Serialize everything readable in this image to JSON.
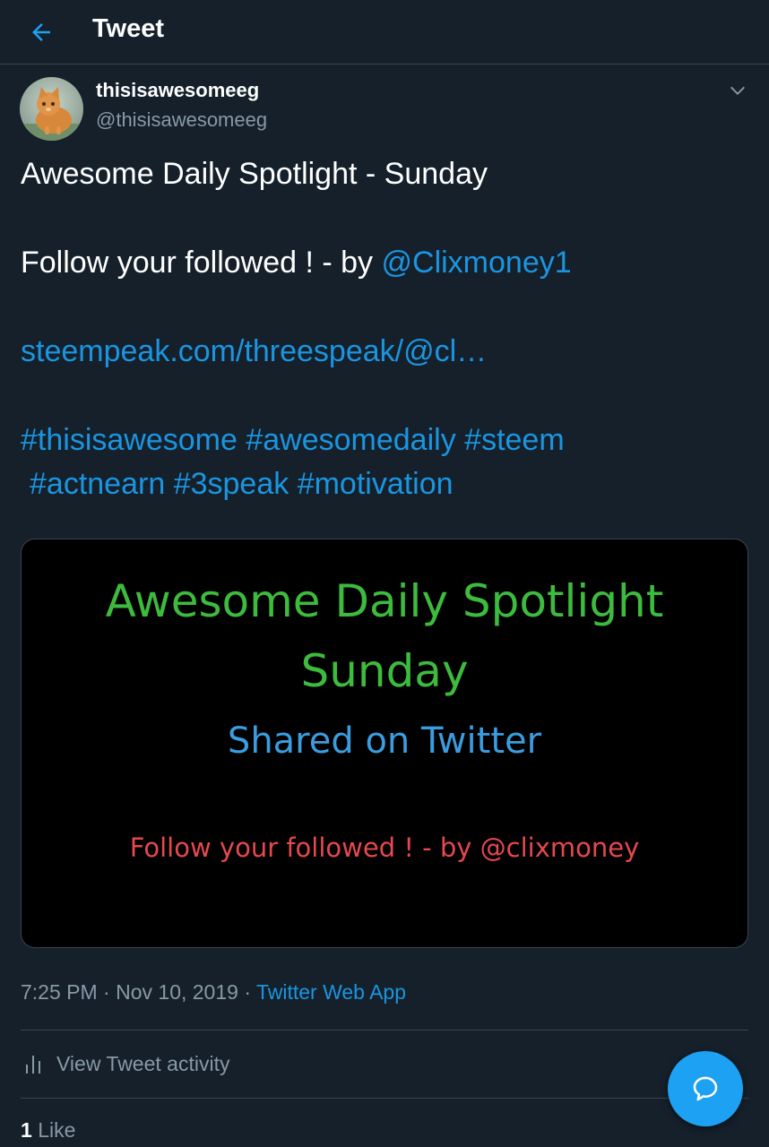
{
  "header": {
    "title": "Tweet",
    "back_icon": "arrow-left-icon"
  },
  "colors": {
    "background": "#15202b",
    "accent": "#1b95e0",
    "secondary_text": "#8899a6",
    "divider": "#38444d",
    "fab": "#1da1f2"
  },
  "author": {
    "display_name": "thisisawesomeeg",
    "handle": "@thisisawesomeeg",
    "avatar_icon": "kitten-avatar"
  },
  "tweet": {
    "line1": "Awesome Daily Spotlight - Sunday",
    "line2_text": "Follow your followed ! - by ",
    "line2_mention": "@Clixmoney1",
    "link": "steempeak.com/threespeak/@cl…",
    "hashtags_row1": [
      "#thisisawesome",
      "#awesomedaily",
      "#steem"
    ],
    "hashtags_row2": [
      "#actnearn",
      "#3speak",
      "#motivation"
    ]
  },
  "media": {
    "title": "Awesome Daily Spotlight",
    "day": "Sunday",
    "subtitle": "Shared on Twitter",
    "credit": "Follow your followed ! - by @clixmoney",
    "colors": {
      "title": "#3dbb3d",
      "subtitle": "#3a9de0",
      "credit": "#e5484d"
    }
  },
  "meta": {
    "time": "7:25 PM",
    "separator": " · ",
    "date": "Nov 10, 2019",
    "source": "Twitter Web App"
  },
  "activity": {
    "label": "View Tweet activity",
    "icon": "bar-chart-icon"
  },
  "likes": {
    "count": "1",
    "label": "Like"
  },
  "fab": {
    "icon": "reply-bubble-icon"
  }
}
